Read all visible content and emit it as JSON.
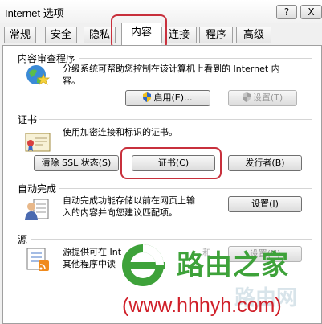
{
  "window": {
    "title": "Internet 选项"
  },
  "titlebar": {
    "help_label": "?",
    "close_label": "X"
  },
  "tabs": [
    {
      "label": "常规"
    },
    {
      "label": "安全"
    },
    {
      "label": "隐私"
    },
    {
      "label": "内容"
    },
    {
      "label": "连接"
    },
    {
      "label": "程序"
    },
    {
      "label": "高级"
    }
  ],
  "content_advisor": {
    "title": "内容审查程序",
    "description_line1": "分级系统可帮助您控制在该计算机上看到的 Internet 内",
    "description_line2": "容。",
    "enable_label": "启用(E)...",
    "settings_label": "设置(T)"
  },
  "certificates": {
    "title": "证书",
    "description": "使用加密连接和标识的证书。",
    "clear_ssl_label": "清除 SSL 状态(S)",
    "certificates_label": "证书(C)",
    "publishers_label": "发行者(B)"
  },
  "autocomplete": {
    "title": "自动完成",
    "description_line1": "自动完成功能存储以前在网页上输",
    "description_line2": "入的内容并向您建议匹配项。",
    "settings_label": "设置(I)"
  },
  "feeds": {
    "title": "源",
    "description_line1": "源提供可在 Int",
    "description_line1_tail": "和",
    "description_line2": "其他程序中读",
    "settings_label": "设置(N)"
  },
  "watermark": {
    "brand": "路由之家",
    "ghost": "路由网",
    "url": "(www.hhhyh.com)"
  },
  "colors": {
    "highlight": "#c8303c",
    "watermark_green": "#3ea23a",
    "watermark_red": "#d0202a"
  }
}
